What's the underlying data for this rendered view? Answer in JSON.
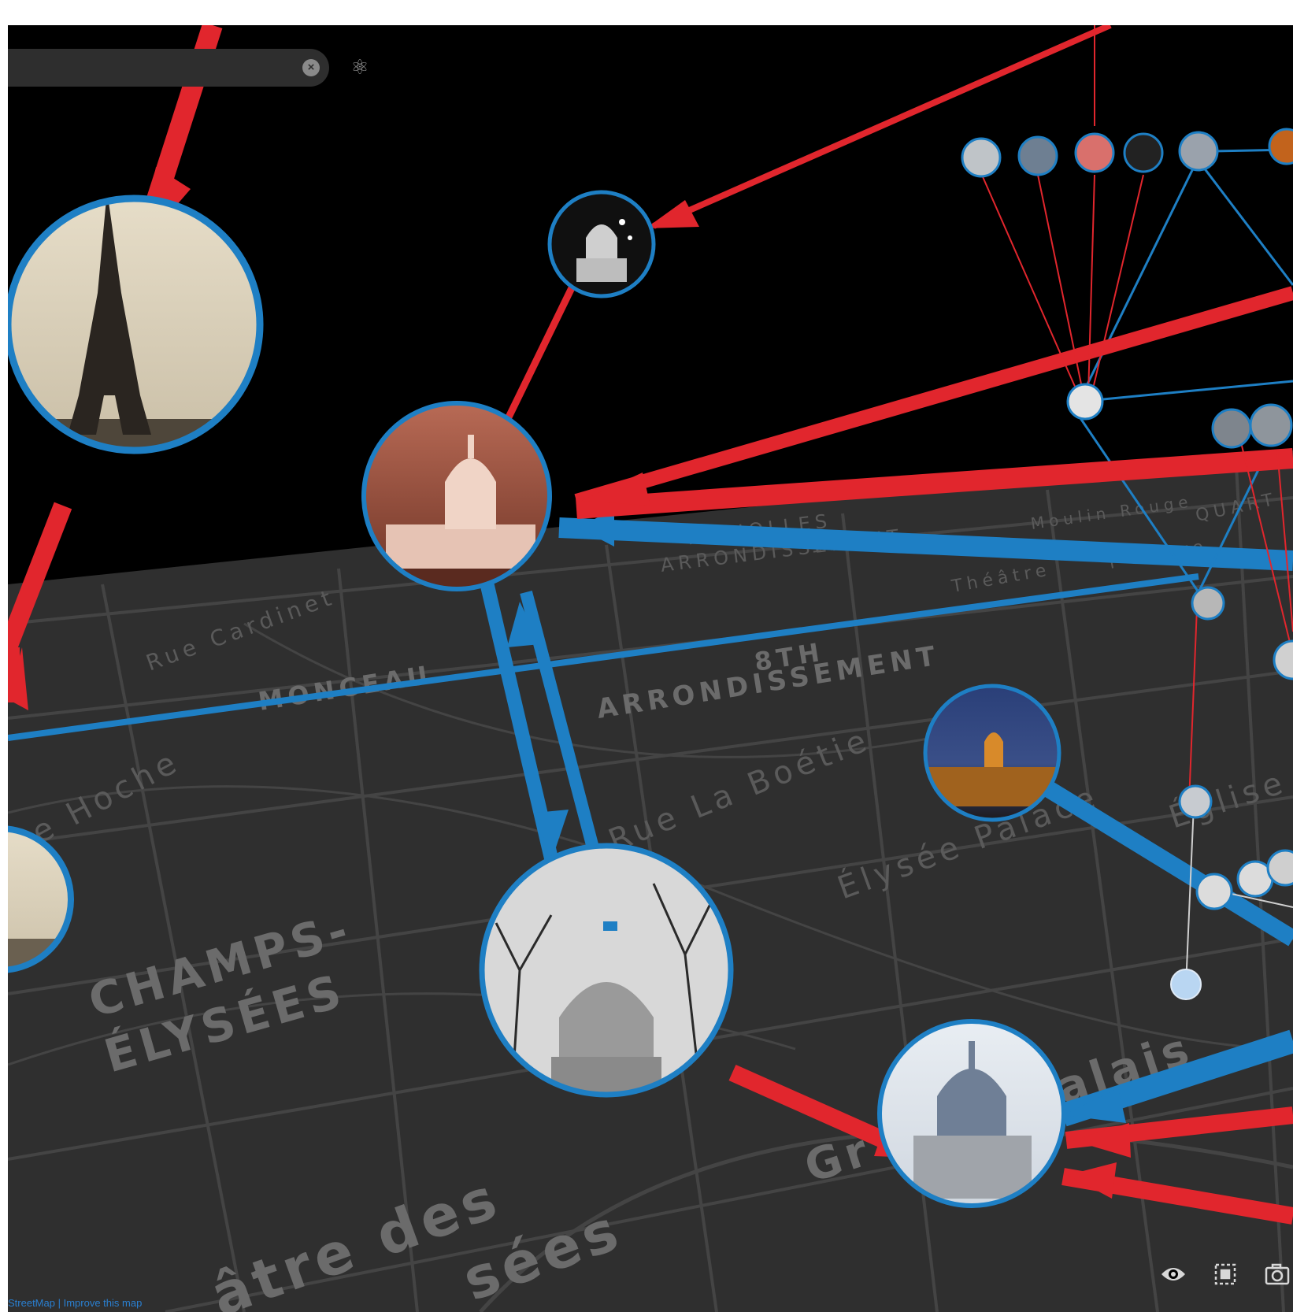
{
  "map": {
    "labels": [
      {
        "id": "lbl-rue-cardinet",
        "text": "Rue Cardinet"
      },
      {
        "id": "lbl-monceau",
        "text": "MONCEAU"
      },
      {
        "id": "lbl-8th",
        "text": "8TH"
      },
      {
        "id": "lbl-8th-arr",
        "text": "ARRONDISSEMENT"
      },
      {
        "id": "lbl-hoche",
        "text": "e Hoche"
      },
      {
        "id": "lbl-boetie",
        "text": "Rue La Boétie"
      },
      {
        "id": "lbl-elysee-palace",
        "text": "Élysée Palace"
      },
      {
        "id": "lbl-eglise",
        "text": "Église"
      },
      {
        "id": "lbl-champs1",
        "text": "CHAMPS-"
      },
      {
        "id": "lbl-champs2",
        "text": "ÉLYSÉES"
      },
      {
        "id": "lbl-batignolles",
        "text": "TIGNOLLES"
      },
      {
        "id": "lbl-17th",
        "text": "17TH"
      },
      {
        "id": "lbl-17th-arr",
        "text": "ARRONDISSEMENT"
      },
      {
        "id": "lbl-moulin",
        "text": "Moulin Rouge"
      },
      {
        "id": "lbl-theatre",
        "text": "Théâtre"
      },
      {
        "id": "lbl-oeuvre",
        "text": "l'Œuvre"
      },
      {
        "id": "lbl-quartier",
        "text": "QUART"
      },
      {
        "id": "lbl-grand-palais-1",
        "text": "alais"
      },
      {
        "id": "lbl-grand-palais-2",
        "text": "Gr"
      },
      {
        "id": "lbl-theatre-des",
        "text": "âtre des"
      },
      {
        "id": "lbl-champs-ees",
        "text": "sées"
      }
    ]
  },
  "search": {
    "placeholder": "",
    "clear_icon": "×",
    "settings_icon": "⚛"
  },
  "toolbar": {
    "eye": "visibility-icon",
    "frame": "fit-frame-icon",
    "camera": "screenshot-icon"
  },
  "attribution": {
    "osm": "StreetMap",
    "sep": " | ",
    "improve": "Improve this map"
  },
  "colors": {
    "link_red": "#e1262d",
    "link_blue": "#1e7fc4",
    "node_ring": "#1e7fc4",
    "map_bg": "#2f2f2f"
  }
}
